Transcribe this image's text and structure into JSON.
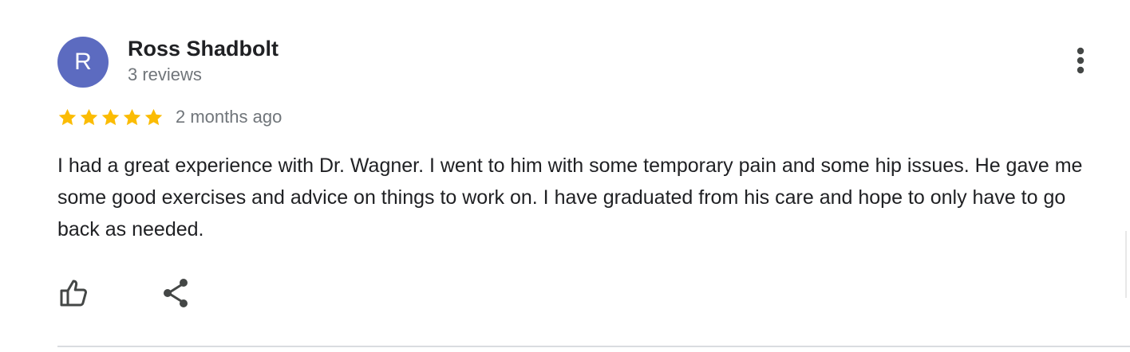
{
  "review": {
    "avatar_initial": "R",
    "reviewer_name": "Ross Shadbolt",
    "review_count": "3 reviews",
    "rating": 5,
    "rating_max": 5,
    "date": "2 months ago",
    "text": "I had a great experience with Dr. Wagner. I went to him with some temporary pain and some hip issues. He gave me some good exercises and advice on things to work on. I have graduated from his care and hope to only have to go back as needed."
  },
  "icons": {
    "more": "more-vert-icon",
    "like": "thumb-up-icon",
    "share": "share-icon",
    "star": "star-icon"
  },
  "colors": {
    "avatar_bg": "#5c6bc0",
    "star": "#fbbc04",
    "muted_text": "#70757a",
    "icon": "#444746"
  }
}
